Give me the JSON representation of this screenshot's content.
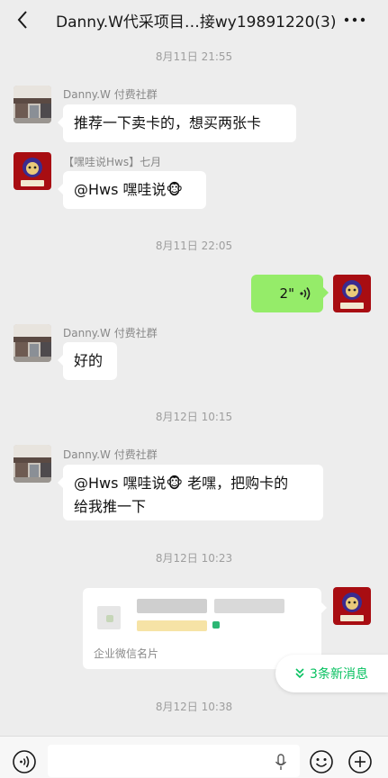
{
  "header": {
    "title": "Danny.W代采项目…接wy19891220(3)",
    "back_icon": "chevron-left-icon",
    "more_icon": "more-dots-icon"
  },
  "messages": {
    "ts1": "8月11日 21:55",
    "m1": {
      "sender": "Danny.W 付费社群",
      "text": "推荐一下卖卡的，想买两张卡"
    },
    "m2": {
      "sender": "【嘿哇说Hws】七月",
      "text": "@Hws 嘿哇说🐵"
    },
    "ts2": "8月11日 22:05",
    "m3": {
      "duration": "2\""
    },
    "m4": {
      "sender": "Danny.W 付费社群",
      "text": "好的"
    },
    "ts3": "8月12日 10:15",
    "m5": {
      "sender": "Danny.W 付费社群",
      "line1": "@Hws 嘿哇说🐵 老嘿，把购卡的",
      "line2": "给我推一下"
    },
    "ts4": "8月12日 10:23",
    "m6": {
      "card_footer": "企业微信名片"
    },
    "ts5": "8月12日 10:38"
  },
  "new_messages": {
    "label": "3条新消息",
    "icon": "double-chevron-down-icon"
  },
  "input_bar": {
    "voice_icon": "voice-mode-icon",
    "mic_icon": "microphone-icon",
    "emoji_icon": "emoji-icon",
    "plus_icon": "plus-icon"
  },
  "colors": {
    "bg": "#ededed",
    "self_bubble": "#95ec69",
    "accent": "#07c160"
  }
}
